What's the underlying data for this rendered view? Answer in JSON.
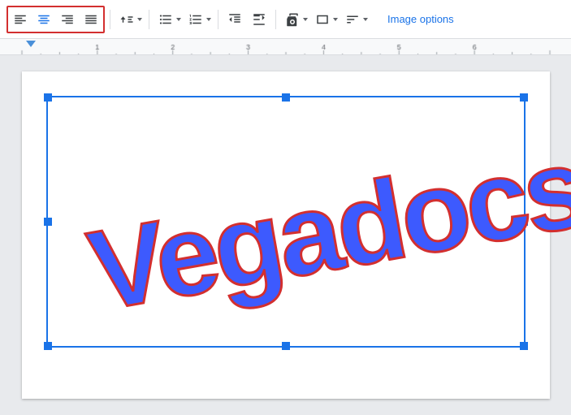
{
  "toolbar": {
    "align_left_label": "Align left",
    "align_center_label": "Align center",
    "align_right_label": "Align right",
    "align_justify_label": "Justify",
    "line_spacing_label": "Line spacing",
    "list_label": "Bulleted list",
    "numbered_list_label": "Numbered list",
    "indent_decrease_label": "Decrease indent",
    "indent_increase_label": "Increase indent",
    "format_label": "Format",
    "image_options_label": "Image options"
  },
  "document": {
    "watermark_text": "Vegadocs"
  }
}
